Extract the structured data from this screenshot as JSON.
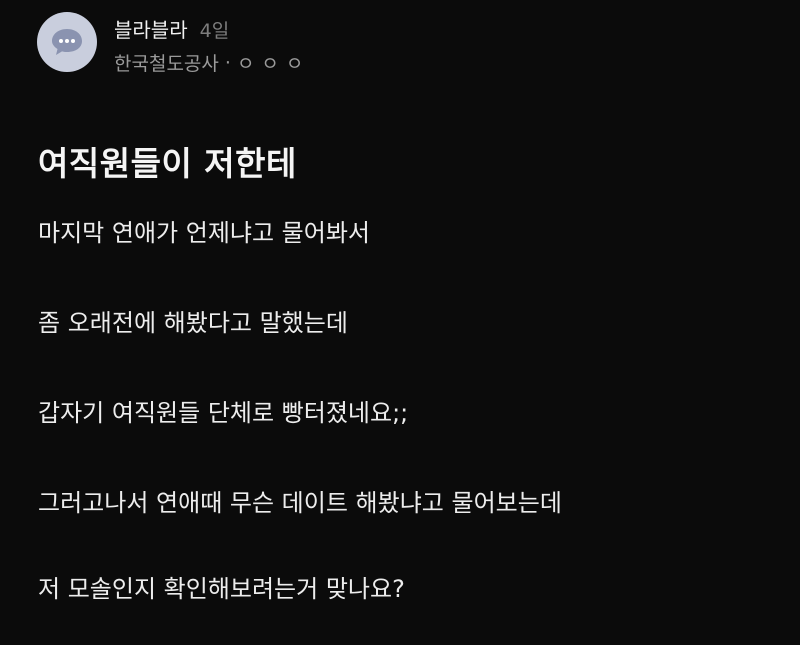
{
  "post": {
    "author": "블라블라",
    "time": "4일",
    "company": "한국철도공사",
    "separator": "·",
    "masked_nickname": "ㅇㅇㅇ",
    "title": "여직원들이 저한테",
    "body_lines": [
      "마지막 연애가 언제냐고 물어봐서",
      "좀 오래전에 해봤다고 말했는데",
      "갑자기 여직원들 단체로 빵터졌네요;;",
      "그러고나서 연애때 무슨 데이트 해봤냐고 물어보는데",
      "저 모솔인지 확인해보려는거 맞나요?"
    ]
  },
  "icons": {
    "avatar": "chat-bubble-icon"
  },
  "colors": {
    "background": "#0b0b0b",
    "avatar_bg": "#c9cedd",
    "bubble": "#8a93b0"
  }
}
